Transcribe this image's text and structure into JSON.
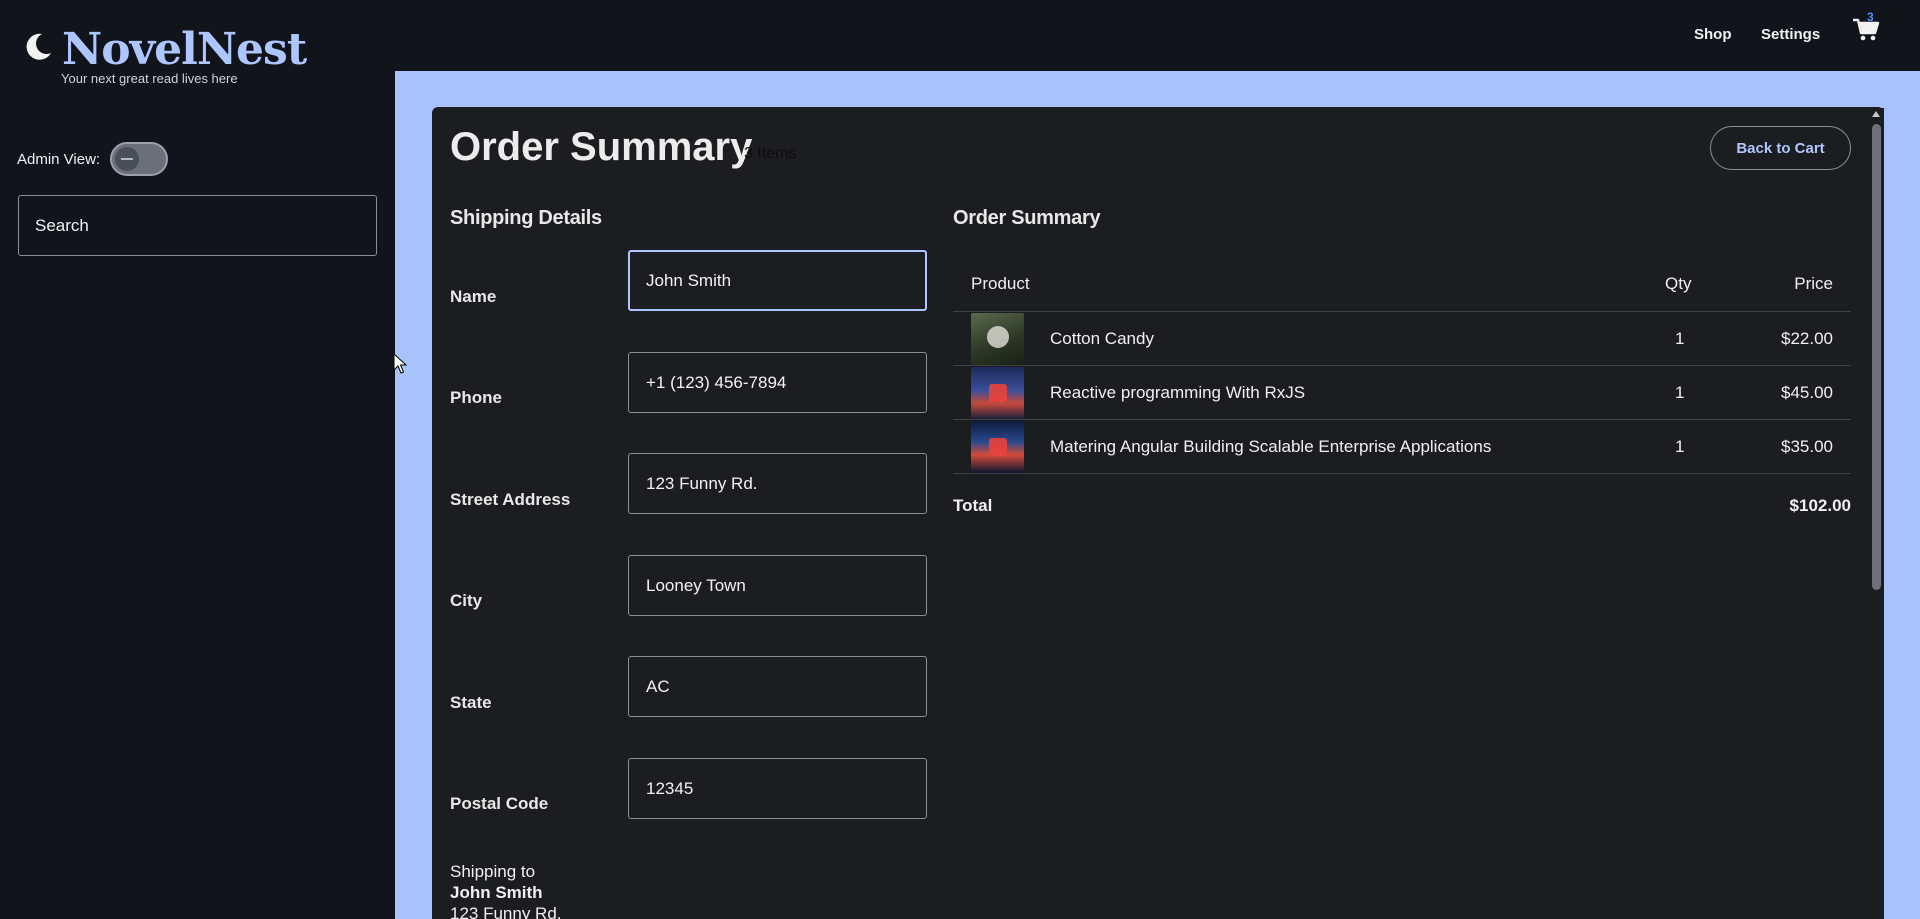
{
  "brand": {
    "name": "NovelNest",
    "tagline": "Your next great read lives here"
  },
  "nav": {
    "shop": "Shop",
    "settings": "Settings",
    "cart_count": "3"
  },
  "sidebar": {
    "admin_label": "Admin View:",
    "search_placeholder": "Search",
    "admin_toggle": "off"
  },
  "page": {
    "title": "Order Summary",
    "item_count": "3 Items",
    "back_button": "Back to Cart"
  },
  "shipping": {
    "heading": "Shipping Details",
    "fields": {
      "name": {
        "label": "Name",
        "value": "John Smith"
      },
      "phone": {
        "label": "Phone",
        "value": "+1 (123) 456-7894"
      },
      "street": {
        "label": "Street Address",
        "value": "123 Funny Rd."
      },
      "city": {
        "label": "City",
        "value": "Looney Town"
      },
      "state": {
        "label": "State",
        "value": "AC"
      },
      "postal": {
        "label": "Postal Code",
        "value": "12345"
      }
    },
    "summary": {
      "prefix": "Shipping to",
      "name": "John Smith",
      "street": "123 Funny Rd."
    }
  },
  "order": {
    "heading": "Order Summary",
    "columns": {
      "product": "Product",
      "qty": "Qty",
      "price": "Price"
    },
    "items": [
      {
        "name": "Cotton Candy",
        "qty": "1",
        "price": "$22.00"
      },
      {
        "name": "Reactive programming With RxJS",
        "qty": "1",
        "price": "$45.00"
      },
      {
        "name": "Matering Angular Building Scalable Enterprise Applications",
        "qty": "1",
        "price": "$35.00"
      }
    ],
    "total_label": "Total",
    "total_value": "$102.00"
  },
  "colors": {
    "accent": "#aec6ff",
    "page_bg": "#11141b",
    "main_bg": "#a8c3fb",
    "card_bg": "#1c1d21",
    "badge": "#4d8dff"
  }
}
